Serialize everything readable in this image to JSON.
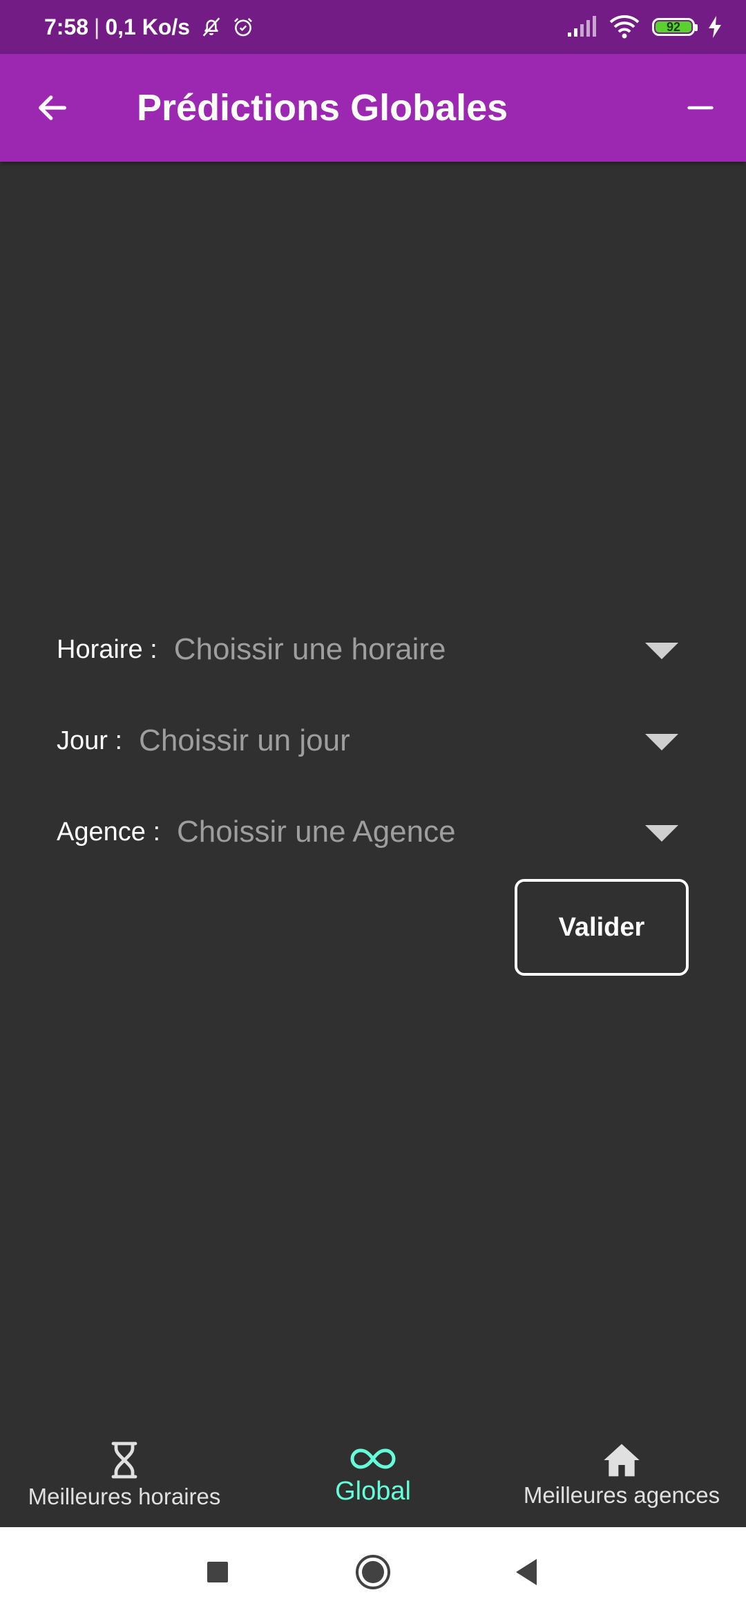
{
  "status_bar": {
    "time": "7:58",
    "separator": "|",
    "net_speed": "0,1 Ko/s",
    "battery": "92"
  },
  "app_bar": {
    "title": "Prédictions Globales"
  },
  "form": {
    "horaire_label": "Horaire :",
    "horaire_placeholder": "Choissir une horaire",
    "jour_label": "Jour :",
    "jour_placeholder": "Choissir un jour",
    "agence_label": "Agence :",
    "agence_placeholder": "Choissir une Agence",
    "submit_label": "Valider"
  },
  "bottom_nav": {
    "items": [
      {
        "label": "Meilleures horaires",
        "icon": "hourglass-icon"
      },
      {
        "label": "Global",
        "icon": "infinity-icon",
        "active": true
      },
      {
        "label": "Meilleures agences",
        "icon": "home-icon"
      }
    ]
  },
  "colors": {
    "status_bar": "#741c86",
    "app_bar": "#9c27b0",
    "background": "#303030",
    "accent": "#64ffda"
  }
}
